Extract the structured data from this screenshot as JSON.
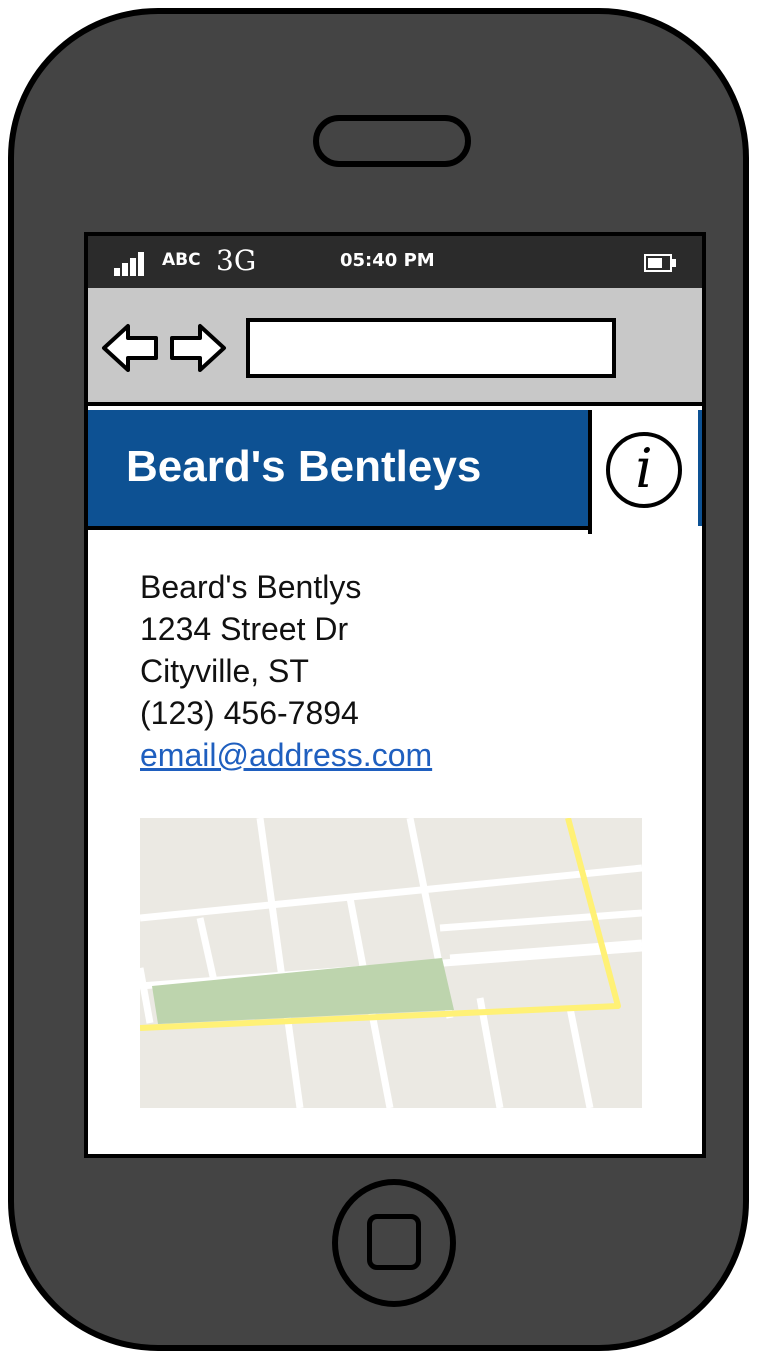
{
  "status_bar": {
    "carrier": "ABC",
    "network": "3G",
    "time": "05:40 PM",
    "signal_icon": "signal-icon",
    "battery_icon": "battery-icon"
  },
  "browser": {
    "back_icon": "back-arrow-icon",
    "forward_icon": "forward-arrow-icon",
    "url_value": ""
  },
  "header": {
    "title": "Beard's Bentleys",
    "info_icon_glyph": "i"
  },
  "contact": {
    "name": "Beard's Bentlys",
    "street": "1234 Street Dr",
    "city": "Cityville, ST",
    "phone": "(123) 456-7894",
    "email": "email@address.com"
  },
  "map": {
    "icon": "map-image"
  },
  "colors": {
    "header_bg": "#0d5193",
    "phone_body": "#444444",
    "link": "#1f5fbf",
    "map_park": "#bdd4ad",
    "map_highway": "#fff176"
  }
}
